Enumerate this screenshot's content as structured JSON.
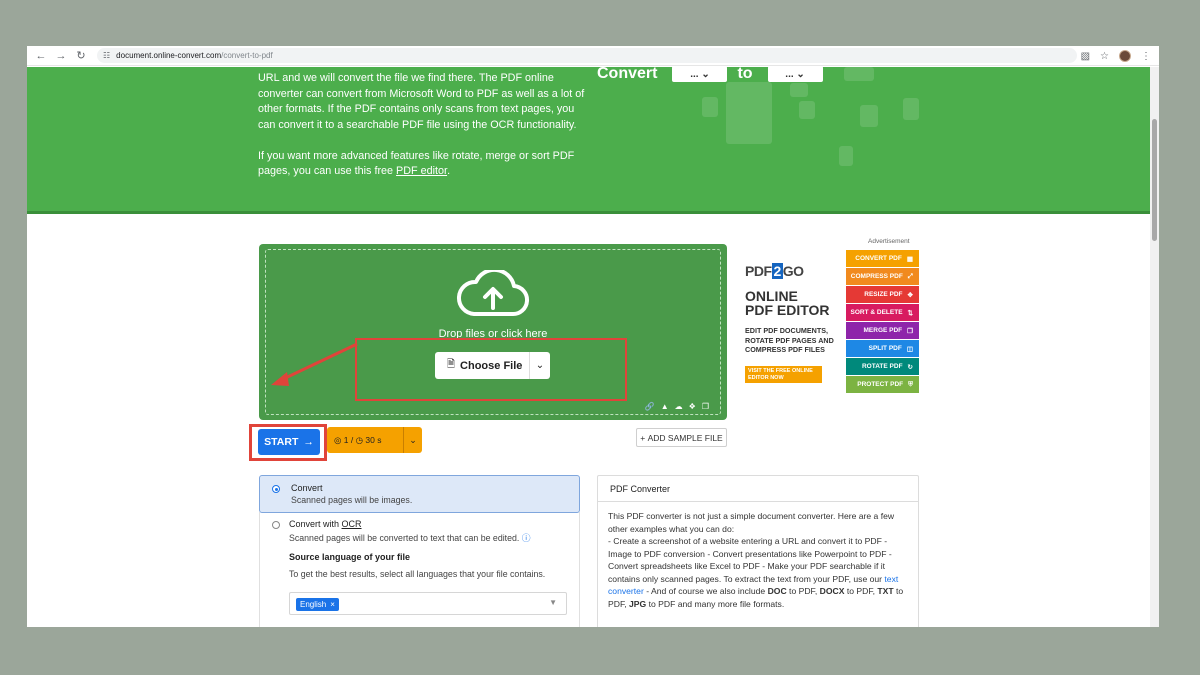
{
  "browser": {
    "url_host": "document.online-convert.com",
    "url_path": "/convert-to-pdf"
  },
  "hero": {
    "paragraph1": "URL and we will convert the file we find there. The PDF online converter can convert from Microsoft Word to PDF as well as a lot of other formats. If the PDF contains only scans from text pages, you can convert it to a searchable PDF file using the OCR functionality.",
    "paragraph2_prefix": "If you want more advanced features like rotate, merge or sort PDF pages, you can use this free ",
    "paragraph2_link": "PDF editor",
    "paragraph2_suffix": ".",
    "convert_label": "Convert",
    "to_label": "to",
    "select1": "...",
    "select2": "..."
  },
  "upload": {
    "drop_text": "Drop files or click here",
    "choose_file": "Choose File"
  },
  "actions": {
    "start": "START",
    "limit_files": "1 /",
    "limit_time": "30 s",
    "add_sample": "ADD SAMPLE FILE"
  },
  "options": {
    "convert_title": "Convert",
    "convert_sub": "Scanned pages will be images.",
    "ocr_title_prefix": "Convert with ",
    "ocr_title_abbr": "OCR",
    "ocr_sub": "Scanned pages will be converted to text that can be edited.",
    "source_lang_title": "Source language of your file",
    "source_lang_sub": "To get the best results, select all languages that your file contains.",
    "selected_language": "English"
  },
  "info": {
    "title": "PDF Converter",
    "text1": "This PDF converter is not just a simple document converter. Here are a few other examples what you can do:",
    "text2": "- Create a screenshot of a website entering a URL and convert it to PDF - Image to PDF conversion - Convert presentations like Powerpoint to PDF - Convert spreadsheets like Excel to PDF - Make your PDF searchable if it contains only scanned pages. To extract the text from your PDF, use our ",
    "link": "text converter",
    "text3a": " - And of course we also include ",
    "b1": "DOC",
    "t1": " to PDF, ",
    "b2": "DOCX",
    "t2": " to PDF, ",
    "b3": "TXT",
    "t3": " to PDF, ",
    "b4": "JPG",
    "t4": " to PDF and many more file formats."
  },
  "ad": {
    "label": "Advertisement",
    "brand_a": "PDF",
    "brand_b": "2",
    "brand_c": "GO",
    "title1": "ONLINE",
    "title2": "PDF EDITOR",
    "desc": "EDIT PDF DOCUMENTS, ROTATE PDF PAGES AND COMPRESS PDF FILES",
    "cta": "VISIT THE FREE ONLINE EDITOR NOW",
    "items": [
      {
        "label": "CONVERT PDF",
        "color": "#f5a100"
      },
      {
        "label": "COMPRESS PDF",
        "color": "#f18a1e"
      },
      {
        "label": "RESIZE PDF",
        "color": "#e53935"
      },
      {
        "label": "SORT & DELETE",
        "color": "#d81b60"
      },
      {
        "label": "MERGE PDF",
        "color": "#8e24aa"
      },
      {
        "label": "SPLIT PDF",
        "color": "#1e88e5"
      },
      {
        "label": "ROTATE PDF",
        "color": "#00897b"
      },
      {
        "label": "PROTECT PDF",
        "color": "#7cb342"
      }
    ]
  },
  "colors": {
    "hero_green": "#4cae4c",
    "upload_green": "#4a9a4a",
    "start_blue": "#1a73e8",
    "limits_orange": "#f5a100",
    "annotation_red": "#e0443a"
  }
}
